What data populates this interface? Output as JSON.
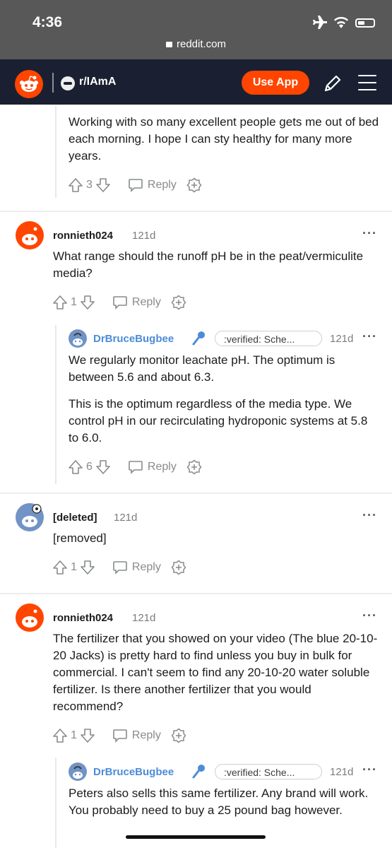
{
  "status": {
    "time": "4:36",
    "url": "reddit.com",
    "icons": [
      "airplane-icon",
      "wifi-icon",
      "battery-icon"
    ]
  },
  "header": {
    "subreddit": "r/IAmA",
    "use_app": "Use App"
  },
  "colors": {
    "accent": "#ff4500",
    "header_bg": "#1a2031",
    "status_bg": "#585858",
    "op_blue": "#4b8cd8"
  },
  "comments": [
    {
      "id": "c0",
      "body": [
        "Working with so many excellent people gets me out of bed each morning. I hope I can sty healthy for many more years."
      ],
      "votes": "3",
      "reply": "Reply"
    },
    {
      "id": "c1",
      "user": "ronnieth024",
      "age": "121d",
      "body": [
        "What range should the runoff pH be in the peat/vermiculite media?"
      ],
      "votes": "1",
      "reply": "Reply"
    },
    {
      "id": "c2",
      "user": "DrBruceBugbee",
      "flair": ":verified: Sche...",
      "age": "121d",
      "body": [
        "We regularly monitor leachate pH. The optimum is between 5.6 and about 6.3.",
        "This is the optimum regardless of the media type. We control pH in our recirculating hydroponic systems at 5.8 to 6.0."
      ],
      "votes": "6",
      "reply": "Reply"
    },
    {
      "id": "c3",
      "user": "[deleted]",
      "age": "121d",
      "body": [
        "[removed]"
      ],
      "votes": "1",
      "reply": "Reply"
    },
    {
      "id": "c4",
      "user": "ronnieth024",
      "age": "121d",
      "body": [
        "The fertilizer that you showed on your video (The blue 20-10-20 Jacks) is pretty hard to find unless you buy in bulk for commercial. I can't seem to find any 20-10-20 water soluble fertilizer. Is there another fertilizer that you would recommend?"
      ],
      "votes": "1",
      "reply": "Reply"
    },
    {
      "id": "c5",
      "user": "DrBruceBugbee",
      "flair": ":verified: Sche...",
      "age": "121d",
      "body": [
        "Peters also sells this same fertilizer. Any brand will work. You probably need to buy a 25 pound bag however."
      ]
    }
  ]
}
